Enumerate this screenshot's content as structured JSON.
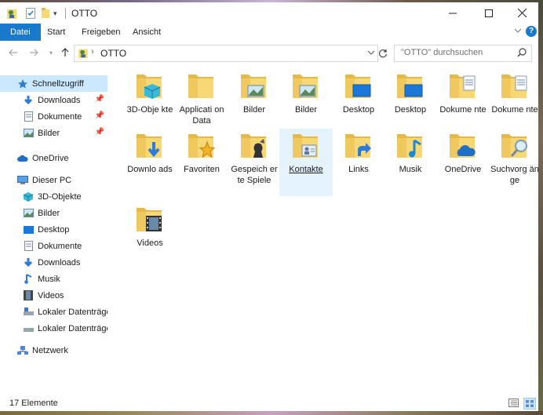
{
  "window": {
    "title": "OTTO"
  },
  "ribbon": {
    "tabs": [
      "Datei",
      "Start",
      "Freigeben",
      "Ansicht"
    ]
  },
  "address": {
    "path": "OTTO",
    "search_placeholder": "\"OTTO\" durchsuchen"
  },
  "sidebar": {
    "quick_access": "Schnellzugriff",
    "quick_items": [
      "Downloads",
      "Dokumente",
      "Bilder"
    ],
    "onedrive": "OneDrive",
    "this_pc": "Dieser PC",
    "pc_items": [
      "3D-Objekte",
      "Bilder",
      "Desktop",
      "Dokumente",
      "Downloads",
      "Musik",
      "Videos",
      "Lokaler Datenträger",
      "Lokaler Datenträger"
    ],
    "network": "Netzwerk"
  },
  "items": [
    {
      "label": "3D-Obje kte",
      "icon": "3d-objects-folder-icon"
    },
    {
      "label": "Applicati on Data",
      "icon": "folder-icon"
    },
    {
      "label": "Bilder",
      "icon": "pictures-folder-icon"
    },
    {
      "label": "Bilder",
      "icon": "pictures-folder-icon"
    },
    {
      "label": "Desktop",
      "icon": "desktop-folder-icon"
    },
    {
      "label": "Desktop",
      "icon": "desktop-folder-icon"
    },
    {
      "label": "Dokume nte",
      "icon": "documents-folder-icon"
    },
    {
      "label": "Dokume nte",
      "icon": "documents-folder-icon"
    },
    {
      "label": "Downlo ads",
      "icon": "downloads-folder-icon"
    },
    {
      "label": "Favoriten",
      "icon": "favorites-folder-icon"
    },
    {
      "label": "Gespeich erte Spiele",
      "icon": "saved-games-folder-icon"
    },
    {
      "label": "Kontakte",
      "icon": "contacts-folder-icon"
    },
    {
      "label": "Links",
      "icon": "links-folder-icon"
    },
    {
      "label": "Musik",
      "icon": "music-folder-icon"
    },
    {
      "label": "OneDrive",
      "icon": "onedrive-folder-icon"
    },
    {
      "label": "Suchvorg änge",
      "icon": "searches-folder-icon"
    },
    {
      "label": "Videos",
      "icon": "videos-folder-icon"
    }
  ],
  "status": {
    "count": "17 Elemente"
  },
  "colors": {
    "accent": "#1979ca",
    "folder": "#f8d775",
    "selection": "#cce8ff"
  }
}
